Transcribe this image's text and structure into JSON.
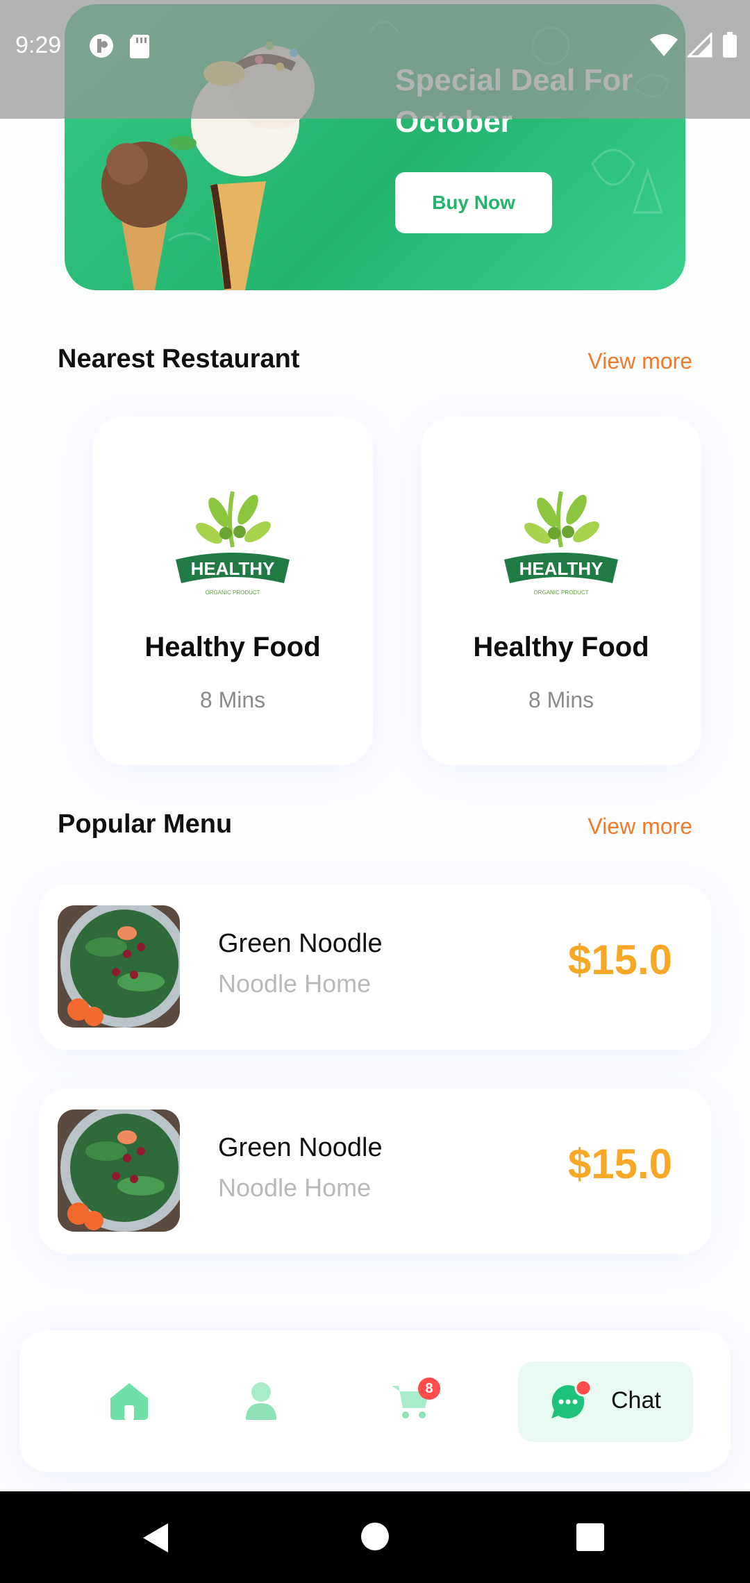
{
  "status_bar": {
    "time": "9:29",
    "left_icons": [
      "app-notification-icon",
      "sd-card-icon"
    ],
    "right_icons": [
      "wifi-icon",
      "cellular-signal-icon",
      "battery-icon"
    ]
  },
  "banner": {
    "title": "Special Deal For October",
    "button_label": "Buy Now",
    "image": "ice-cream-cones"
  },
  "nearest_restaurant": {
    "title": "Nearest Restaurant",
    "view_more": "View more",
    "items": [
      {
        "name": "Healthy Food",
        "time": "8 Mins",
        "logo_text": "HEALTHY",
        "logo_subtext": "ORGANIC PRODUCT"
      },
      {
        "name": "Healthy Food",
        "time": "8 Mins",
        "logo_text": "HEALTHY",
        "logo_subtext": "ORGANIC PRODUCT"
      }
    ]
  },
  "popular_menu": {
    "title": "Popular Menu",
    "view_more": "View more",
    "items": [
      {
        "name": "Green Noodle",
        "restaurant": "Noodle Home",
        "price": "$15.0"
      },
      {
        "name": "Green Noodle",
        "restaurant": "Noodle Home",
        "price": "$15.0"
      }
    ]
  },
  "bottom_nav": {
    "items": [
      {
        "icon": "home-icon"
      },
      {
        "icon": "profile-icon"
      },
      {
        "icon": "cart-icon",
        "badge": "8"
      },
      {
        "icon": "chat-icon",
        "label": "Chat",
        "active": true
      }
    ]
  },
  "system_nav": [
    "back-icon",
    "home-circle-icon",
    "recents-icon"
  ],
  "colors": {
    "primary_green": "#24b46e",
    "accent_orange": "#f07b2a",
    "price_yellow": "#f9a826",
    "badge_red": "#ff4b4b"
  }
}
